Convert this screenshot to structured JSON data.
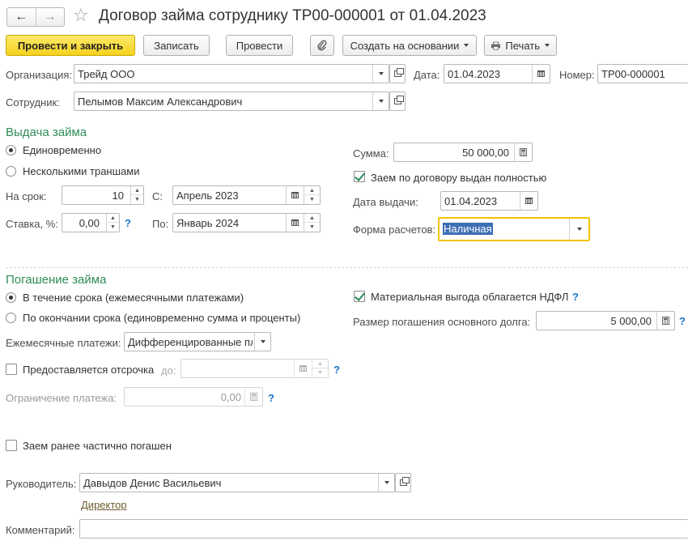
{
  "header": {
    "title": "Договор займа сотруднику ТР00-000001 от 01.04.2023",
    "back_glyph": "←",
    "forward_glyph": "→",
    "star_glyph": "☆"
  },
  "toolbar": {
    "post_close": "Провести и закрыть",
    "save": "Записать",
    "post": "Провести",
    "create_based": "Создать на основании",
    "print": "Печать"
  },
  "org": {
    "label": "Организация:",
    "value": "Трейд ООО"
  },
  "date": {
    "label": "Дата:",
    "value": "01.04.2023"
  },
  "number": {
    "label": "Номер:",
    "value": "ТР00-000001"
  },
  "employee": {
    "label": "Сотрудник:",
    "value": "Пелымов Максим Александрович"
  },
  "issue": {
    "title": "Выдача займа",
    "radio_once": "Единовременно",
    "radio_tranches": "Несколькими траншами",
    "term_label": "На срок:",
    "term_value": "10",
    "from_label": "С:",
    "from_value": "Апрель 2023",
    "rate_label": "Ставка, %:",
    "rate_value": "0,00",
    "to_label": "По:",
    "to_value": "Январь 2024",
    "sum_label": "Сумма:",
    "sum_value": "50 000,00",
    "fully_issued_label": "Заем по договору выдан полностью",
    "issue_date_label": "Дата выдачи:",
    "issue_date_value": "01.04.2023",
    "payment_form_label": "Форма расчетов:",
    "payment_form_value": "Наличная"
  },
  "repay": {
    "title": "Погашение займа",
    "radio_monthly": "В течение срока (ежемесячными платежами)",
    "radio_end": "По окончании срока (единовременно сумма и проценты)",
    "monthly_label": "Ежемесячные платежи:",
    "monthly_value": "Дифференцированные пл",
    "deferral_label": "Предоставляется отсрочка",
    "deferral_to_label": "до:",
    "limit_label": "Ограничение платежа:",
    "limit_value": "0,00",
    "ndfl_label": "Материальная выгода облагается НДФЛ",
    "principal_label": "Размер погашения основного долга:",
    "principal_value": "5 000,00"
  },
  "partial": {
    "label": "Заем ранее частично погашен"
  },
  "manager": {
    "label": "Руководитель:",
    "value": "Давыдов Денис Васильевич",
    "position": "Директор"
  },
  "comment": {
    "label": "Комментарий:",
    "value": ""
  },
  "help_glyph": "?",
  "colors": {
    "accent": "#2e8b57",
    "primary_button": "#f5d21d",
    "focus": "#f2c200",
    "help": "#1a73c8"
  }
}
